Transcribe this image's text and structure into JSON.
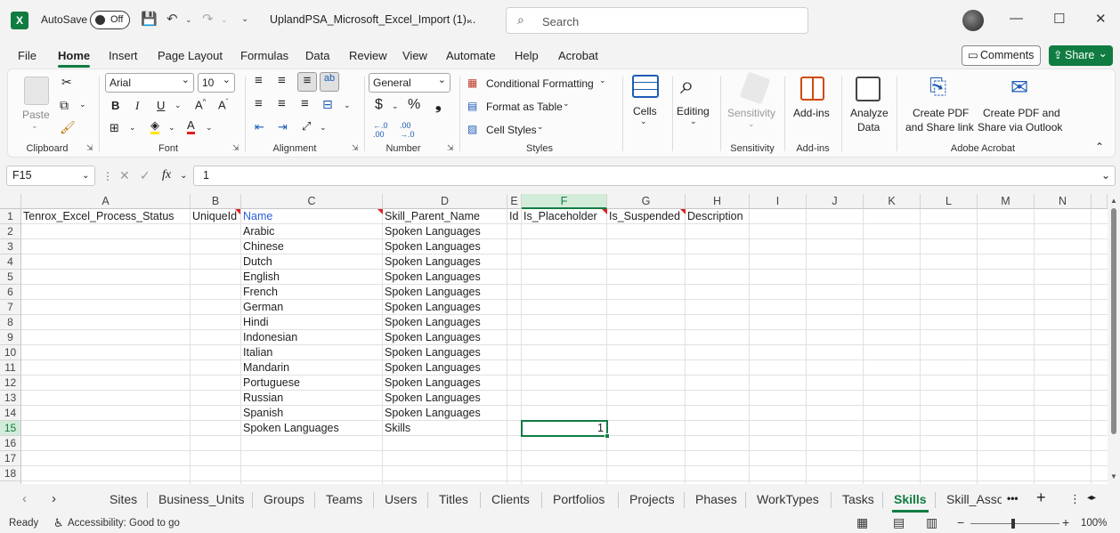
{
  "titlebar": {
    "autosave_label": "AutoSave",
    "autosave_state": "Off",
    "document_name": "UplandPSA_Microsoft_Excel_Import (1)...",
    "search_placeholder": "Search"
  },
  "menu": {
    "tabs": [
      "File",
      "Home",
      "Insert",
      "Page Layout",
      "Formulas",
      "Data",
      "Review",
      "View",
      "Automate",
      "Help",
      "Acrobat"
    ],
    "active": "Home",
    "comments_label": "Comments",
    "share_label": "Share"
  },
  "ribbon": {
    "clipboard": {
      "label": "Clipboard",
      "paste": "Paste"
    },
    "font": {
      "label": "Font",
      "family": "Arial",
      "size": "10"
    },
    "alignment": {
      "label": "Alignment"
    },
    "number": {
      "label": "Number",
      "format": "General"
    },
    "styles": {
      "label": "Styles",
      "conditional": "Conditional Formatting",
      "format_table": "Format as Table",
      "cell_styles": "Cell Styles"
    },
    "cells": {
      "label": "Cells"
    },
    "editing": {
      "label": "Editing"
    },
    "sensitivity": {
      "label": "Sensitivity",
      "button": "Sensitivity"
    },
    "addins": {
      "label": "Add-ins",
      "button": "Add-ins"
    },
    "analyze": {
      "line1": "Analyze",
      "line2": "Data"
    },
    "acrobat": {
      "label": "Adobe Acrobat",
      "pdf_link_line1": "Create PDF",
      "pdf_link_line2": "and Share link",
      "pdf_outlook_line1": "Create PDF and",
      "pdf_outlook_line2": "Share via Outlook"
    }
  },
  "formula_bar": {
    "name_box": "F15",
    "fx": "fx",
    "value": "1"
  },
  "grid": {
    "columns": [
      "A",
      "B",
      "C",
      "D",
      "E",
      "F",
      "G",
      "H",
      "I",
      "J",
      "K",
      "L",
      "M",
      "N"
    ],
    "selected_column": "F",
    "rows": [
      "1",
      "2",
      "3",
      "4",
      "5",
      "6",
      "7",
      "8",
      "9",
      "10",
      "11",
      "12",
      "13",
      "14",
      "15",
      "16",
      "17",
      "18"
    ],
    "selected_row": "15",
    "headers": {
      "A": "Tenrox_Excel_Process_Status",
      "B": "UniqueId",
      "C": "Name",
      "D": "Skill_Parent_Name",
      "E": "Id",
      "F": "Is_Placeholder",
      "G": "Is_Suspended",
      "H": "Description"
    },
    "names": [
      "Arabic",
      "Chinese",
      "Dutch",
      "English",
      "French",
      "German",
      "Hindi",
      "Indonesian",
      "Italian",
      "Mandarin",
      "Portuguese",
      "Russian",
      "Spanish",
      "Spoken Languages"
    ],
    "parents": [
      "Spoken Languages",
      "Spoken Languages",
      "Spoken Languages",
      "Spoken Languages",
      "Spoken Languages",
      "Spoken Languages",
      "Spoken Languages",
      "Spoken Languages",
      "Spoken Languages",
      "Spoken Languages",
      "Spoken Languages",
      "Spoken Languages",
      "Spoken Languages",
      "Skills"
    ],
    "f15_value": "1"
  },
  "sheets": {
    "tabs": [
      "Sites",
      "Business_Units",
      "Groups",
      "Teams",
      "Users",
      "Titles",
      "Clients",
      "Portfolios",
      "Projects",
      "Phases",
      "WorkTypes",
      "Tasks",
      "Skills",
      "Skill_Asso"
    ],
    "active": "Skills",
    "more": "•••",
    "add": "+"
  },
  "status": {
    "ready": "Ready",
    "accessibility": "Accessibility: Good to go",
    "zoom": "100%"
  }
}
